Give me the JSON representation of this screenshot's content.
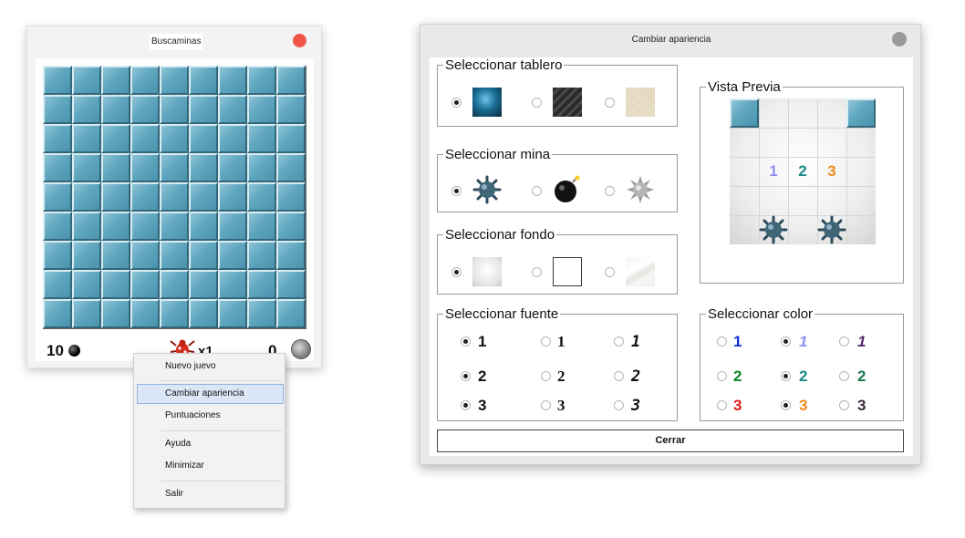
{
  "game_window": {
    "title": "Buscaminas",
    "mines_remaining": "10",
    "flags_label": "x1",
    "time": "0",
    "grid_rows": 9,
    "grid_cols": 9
  },
  "context_menu": {
    "items": [
      {
        "label": "Nuevo juevo"
      },
      {
        "label": "Cambiar apariencia",
        "selected": true
      },
      {
        "label": "Puntuaciones"
      },
      {
        "label": "Ayuda"
      },
      {
        "label": "Minimizar"
      },
      {
        "label": "Salir"
      }
    ]
  },
  "dialog": {
    "title": "Cambiar apariencia",
    "board_group": {
      "legend": "Seleccionar tablero",
      "selected_index": 0,
      "options": [
        "blue-tile-swatch",
        "dark-striped-swatch",
        "linen-swatch"
      ]
    },
    "mine_group": {
      "legend": "Seleccionar mina",
      "selected_index": 0,
      "options": [
        "spiked-mine-icon",
        "bomb-icon",
        "spiky-ball-icon"
      ]
    },
    "background_group": {
      "legend": "Seleccionar fondo",
      "selected_index": 0,
      "options": [
        "gray-gradient-swatch",
        "white-swatch",
        "marble-swatch"
      ]
    },
    "font_group": {
      "legend": "Seleccionar fuente",
      "selected_index": 0,
      "columns": [
        {
          "digits": [
            "1",
            "2",
            "3"
          ]
        },
        {
          "digits": [
            "1",
            "2",
            "3"
          ]
        },
        {
          "digits": [
            "1",
            "2",
            "3"
          ]
        }
      ]
    },
    "preview": {
      "legend": "Vista Previa",
      "numbers": [
        "1",
        "2",
        "3"
      ]
    },
    "color_group": {
      "legend": "Seleccionar color",
      "selected_index": 1,
      "columns": [
        {
          "digits": [
            "1",
            "2",
            "3"
          ],
          "colors": [
            "#0a2fd6",
            "#0a8a2a",
            "#e01818"
          ]
        },
        {
          "digits": [
            "1",
            "2",
            "3"
          ],
          "colors": [
            "#8f8ff2",
            "#1a8a86",
            "#f08a1c"
          ]
        },
        {
          "digits": [
            "1",
            "2",
            "3"
          ],
          "colors": [
            "#5a2a6a",
            "#1a7a50",
            "#3a2a3a"
          ]
        }
      ]
    },
    "close_label": "Cerrar"
  },
  "colors": {
    "tile": "#5fa6bf",
    "close_red": "#f0564a",
    "menu_highlight": "#dbe7f7"
  }
}
